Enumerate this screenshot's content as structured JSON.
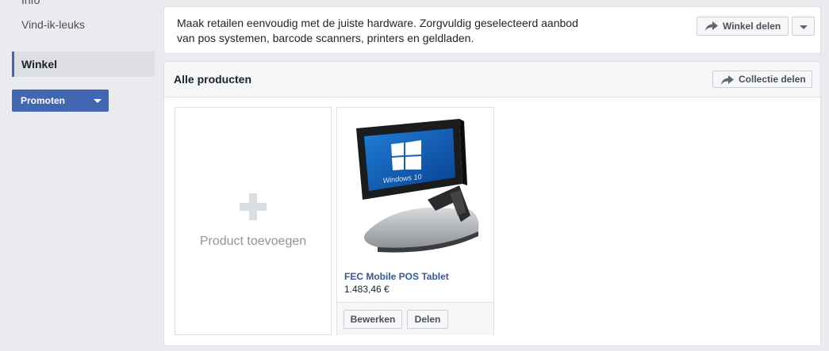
{
  "sidebar": {
    "items": [
      {
        "label": "Info"
      },
      {
        "label": "Vind-ik-leuks"
      },
      {
        "label": "Winkel",
        "active": true
      }
    ],
    "promote_label": "Promoten"
  },
  "shop": {
    "description": "Maak retailen eenvoudig met de juiste hardware. Zorgvuldig geselecteerd aanbod van pos systemen, barcode scanners, printers en geldladen.",
    "share_label": "Winkel delen"
  },
  "collection": {
    "title": "Alle producten",
    "share_label": "Collectie delen",
    "add_product_label": "Product toevoegen",
    "products": [
      {
        "name": "FEC Mobile POS Tablet",
        "price": "1.483,46 €",
        "screen_text": "Windows 10",
        "edit_label": "Bewerken",
        "share_label": "Delen"
      }
    ]
  },
  "colors": {
    "accent": "#4267b2",
    "link": "#365899",
    "background": "#e9ebee"
  },
  "icons": [
    "share-arrow-icon",
    "chevron-down-icon",
    "plus-icon"
  ]
}
